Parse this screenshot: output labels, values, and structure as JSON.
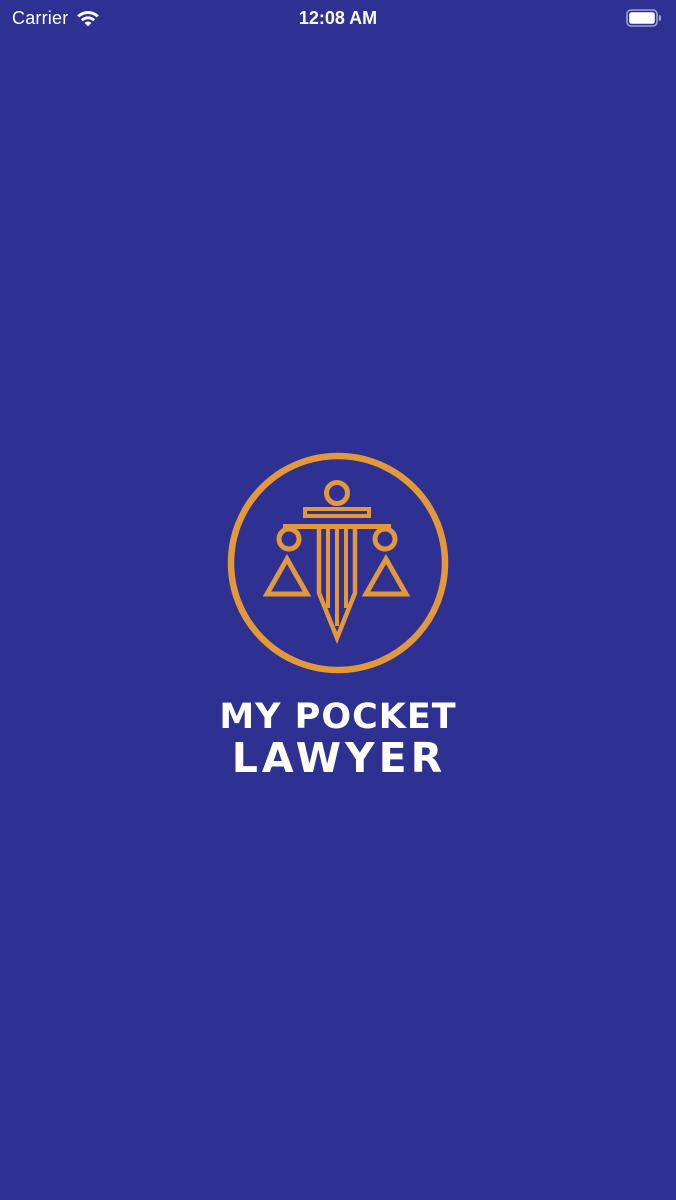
{
  "status_bar": {
    "carrier": "Carrier",
    "time": "12:08 AM",
    "wifi_icon": "wifi-icon",
    "battery_icon": "battery-icon"
  },
  "splash": {
    "brand_line1": "MY POCKET",
    "brand_line2": "LAWYER",
    "emblem_icon": "scales-of-justice-sword-icon"
  },
  "colors": {
    "background": "#2e3191",
    "accent": "#e3993a",
    "text": "#ffffff"
  }
}
